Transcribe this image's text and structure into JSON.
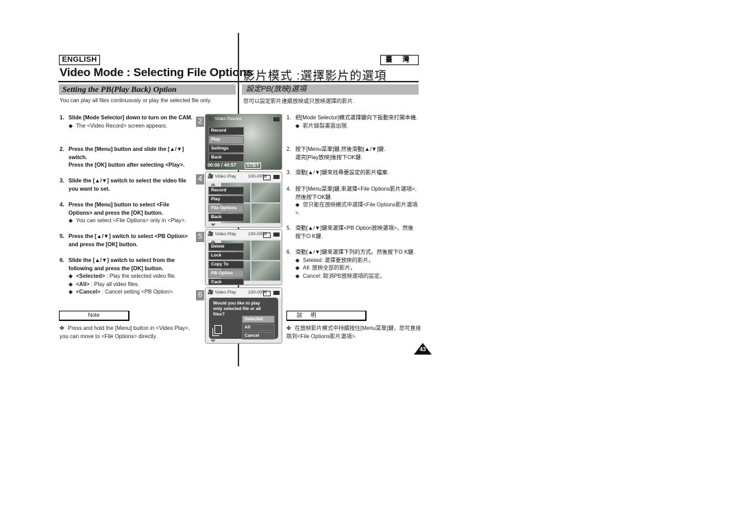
{
  "header": {
    "language_en": "ENGLISH",
    "language_zh": "臺 灣",
    "title_en": "Video Mode : Selecting File Options",
    "title_zh": "影片模式 :選擇影片的選項"
  },
  "section": {
    "title_en": "Setting the PB(Play Back) Option",
    "title_zh": "設定PB(放映)選項",
    "intro_en": "You can play all files continuously or play the selected file only.",
    "intro_zh": "您可以設定影片連續放映或只放映選擇的影片."
  },
  "steps_en": [
    {
      "num": "1.",
      "text": "Slide [Mode Selector] down to turn on the CAM.",
      "bullets": [
        "The <Video Record> screen appears."
      ]
    },
    {
      "num": "2.",
      "text": "Press the [Menu] button and slide the [▲/▼] switch.",
      "text2": "Press the [OK] button after selecting <Play>.",
      "bullets": []
    },
    {
      "num": "3.",
      "text": "Slide the [▲/▼] switch to select the video file you want to set.",
      "bullets": []
    },
    {
      "num": "4.",
      "text": "Press the [Menu] button to select <File Options> and press the [OK] button.",
      "bullets": [
        "You can select <File Options> only in <Play>."
      ]
    },
    {
      "num": "5.",
      "text": "Press the [▲/▼] switch to select <PB Option> and press the [OK] button.",
      "bullets": []
    },
    {
      "num": "6.",
      "text": "Slide the [▲/▼] switch to select from the following and press the [OK] button.",
      "options": [
        {
          "key": "<Selected>",
          "desc": " : Play the selected video file."
        },
        {
          "key": "<All>",
          "desc": " : Play all video files."
        },
        {
          "key": "<Cancel>",
          "desc": " : Cancel setting <PB Option>."
        }
      ]
    }
  ],
  "steps_zh": [
    {
      "num": "1.",
      "text": "把[Mode Selector]模式選擇鍵向下扳動來打開本機.",
      "bullets": [
        "影片錄製畫面出現."
      ]
    },
    {
      "num": "2.",
      "text": "按下[Menu菜單]鍵,然後滑動[▲/▼]鍵.",
      "text2": "選完[Play放映]後按下OK鍵.",
      "bullets": []
    },
    {
      "num": "3.",
      "text": "滑動[▲/▼]鍵來找尋要設定的影片檔案.",
      "bullets": []
    },
    {
      "num": "4.",
      "text": "按下[Menu菜單]鍵,來選擇<File Options影片選項>,然後按下OK鍵.",
      "bullets": [
        "您只能在放映模式中選擇<File Options影片選項>."
      ]
    },
    {
      "num": "5.",
      "text": "滑動[▲/▼]鍵來選擇<PB Option放映選項>，然後按下O K鍵.",
      "bullets": []
    },
    {
      "num": "6.",
      "text": "滑動[▲/▼]鍵來選擇下列的方式。然後按下O K鍵.",
      "bullets": [
        "Seleted: 選擇要放映的影片。",
        "All: 放映全部的影片。",
        "Cancel: 取消PB放映選項的設定。"
      ]
    }
  ],
  "note": {
    "label_en": "Note",
    "text_en": "Press and hold the [Menu] button in <Video Play>, you can move to <File Options> directly.",
    "label_zh": "說 明",
    "text_zh": "在放映影片模式中持續按住[Menu菜單]鍵，您可直接跳到<File Options影片選項>."
  },
  "screens": [
    {
      "step": "2",
      "title": "Video Record",
      "menu": [
        "Record",
        "Play",
        "Settings",
        "Back"
      ],
      "selected": "Play",
      "timecode": "00:00",
      "remaining": "40:57",
      "status": "STBY"
    },
    {
      "step": "4",
      "title": "Video Play",
      "file": "100-0056",
      "menu": [
        "Record",
        "Play",
        "File Options",
        "Back"
      ],
      "selected": "File Options"
    },
    {
      "step": "5",
      "title": "Video Play",
      "file": "100-0056",
      "menu": [
        "Delete",
        "Lock",
        "Copy To",
        "PB Option",
        "Back"
      ],
      "selected": "PB Option"
    },
    {
      "step": "6",
      "title": "Video Play",
      "file": "100-0056",
      "question": "Would you like to play only selected file or all files?",
      "options": [
        "Selected",
        "All",
        "Cancel"
      ],
      "selected": "Selected"
    }
  ],
  "page_number": "43"
}
